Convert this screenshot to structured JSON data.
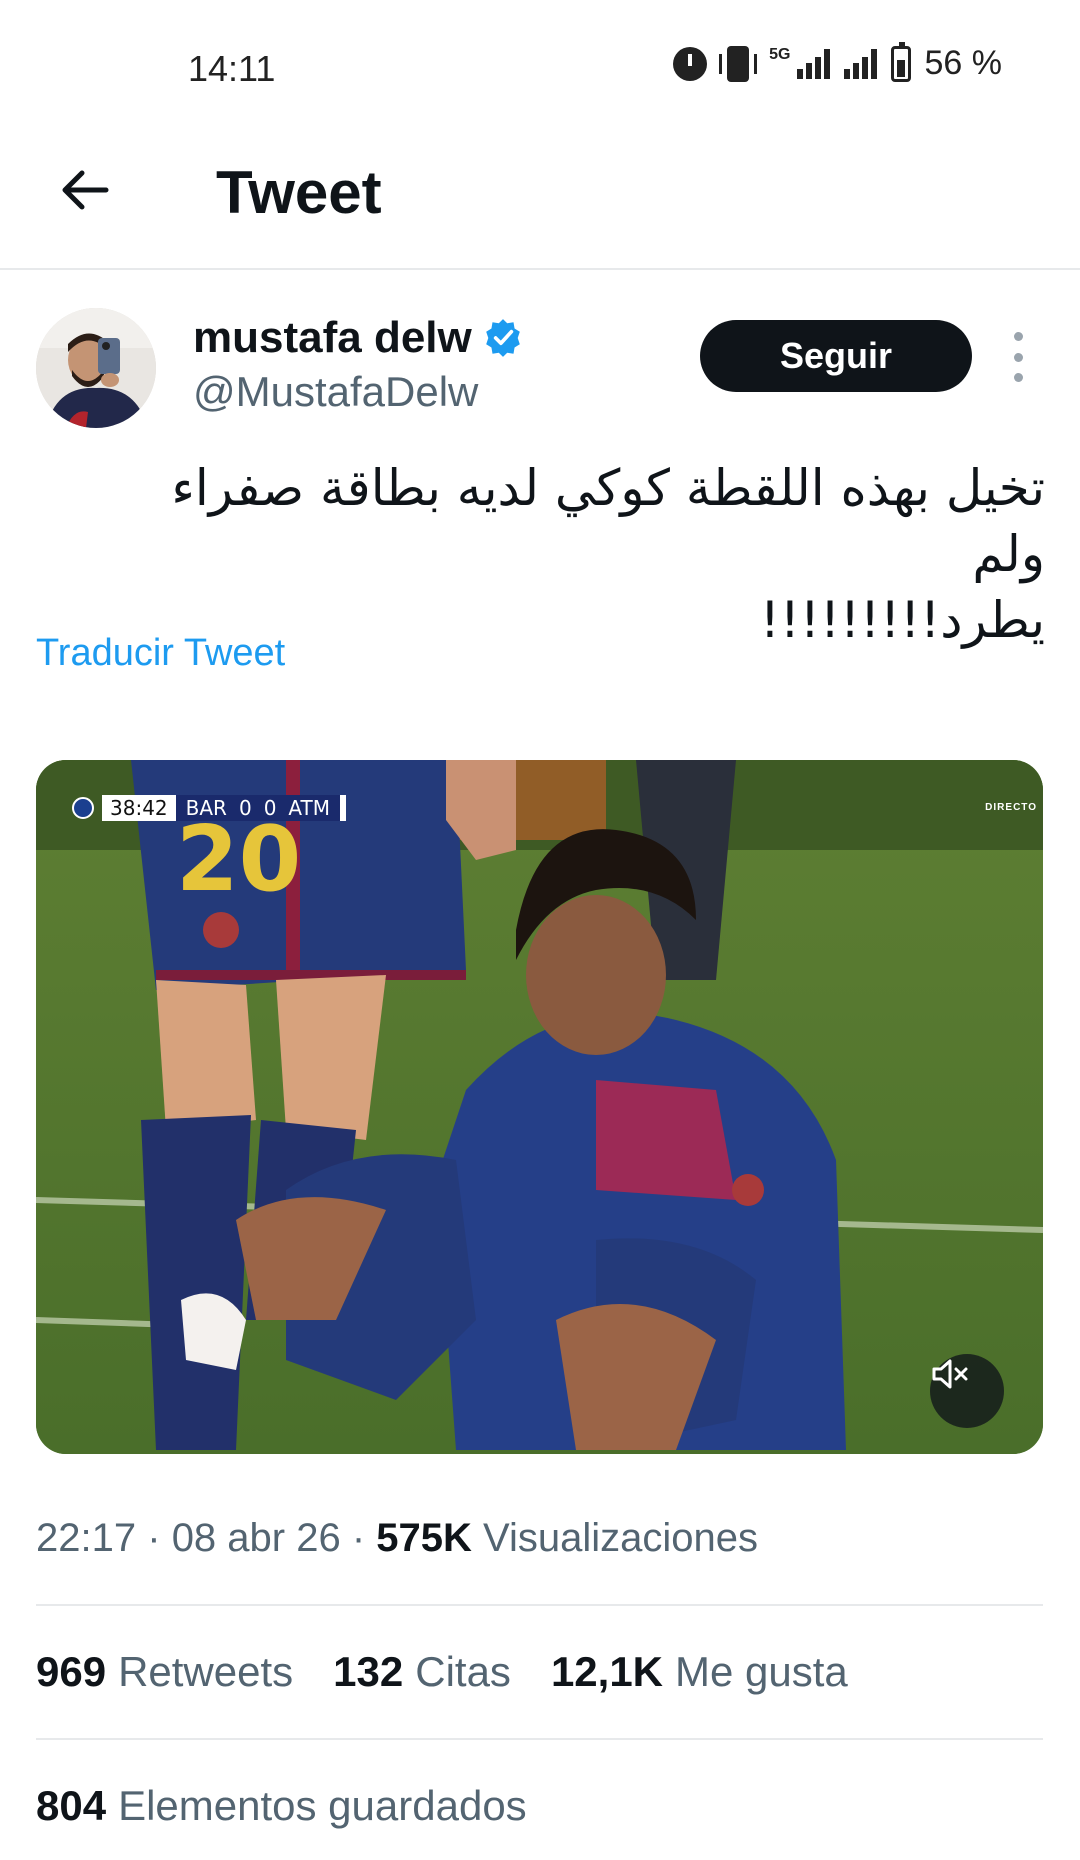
{
  "status_bar": {
    "time": "14:11",
    "network_label": "5G",
    "battery": "56 %",
    "icons": [
      "alarm-icon",
      "vibrate-icon",
      "signal-5g-icon",
      "signal-icon",
      "battery-icon"
    ]
  },
  "header": {
    "title": "Tweet",
    "back_icon": "arrow-left-icon"
  },
  "tweet": {
    "author": {
      "name": "mustafa delw",
      "handle": "@MustafaDelw",
      "verified": true
    },
    "follow_label": "Seguir",
    "text_line1": "تخيل بهذه اللقطة كوكي لديه بطاقة صفراء ولم",
    "text_line2": "يطرد!!!!!!!!!",
    "translate_label": "Traducir Tweet",
    "media": {
      "scoreboard": {
        "clock": "38:42",
        "home": "BAR",
        "home_score": "0",
        "away_score": "0",
        "away": "ATM"
      },
      "broadcast_label": "DIRECTO",
      "shirt_number": "20",
      "mute_icon": "speaker-muted-icon"
    },
    "time": "22:17",
    "date": "08 abr 26",
    "separator": "·",
    "views_count": "575K",
    "views_label": "Visualizaciones",
    "retweets_count": "969",
    "retweets_label": "Retweets",
    "quotes_count": "132",
    "quotes_label": "Citas",
    "likes_count": "12,1K",
    "likes_label": "Me gusta",
    "bookmarks_count": "804",
    "bookmarks_label": "Elementos guardados"
  },
  "colors": {
    "accent": "#1d9bf0",
    "text_primary": "#0f1419",
    "text_secondary": "#536471",
    "follow_bg": "#0f1419"
  }
}
